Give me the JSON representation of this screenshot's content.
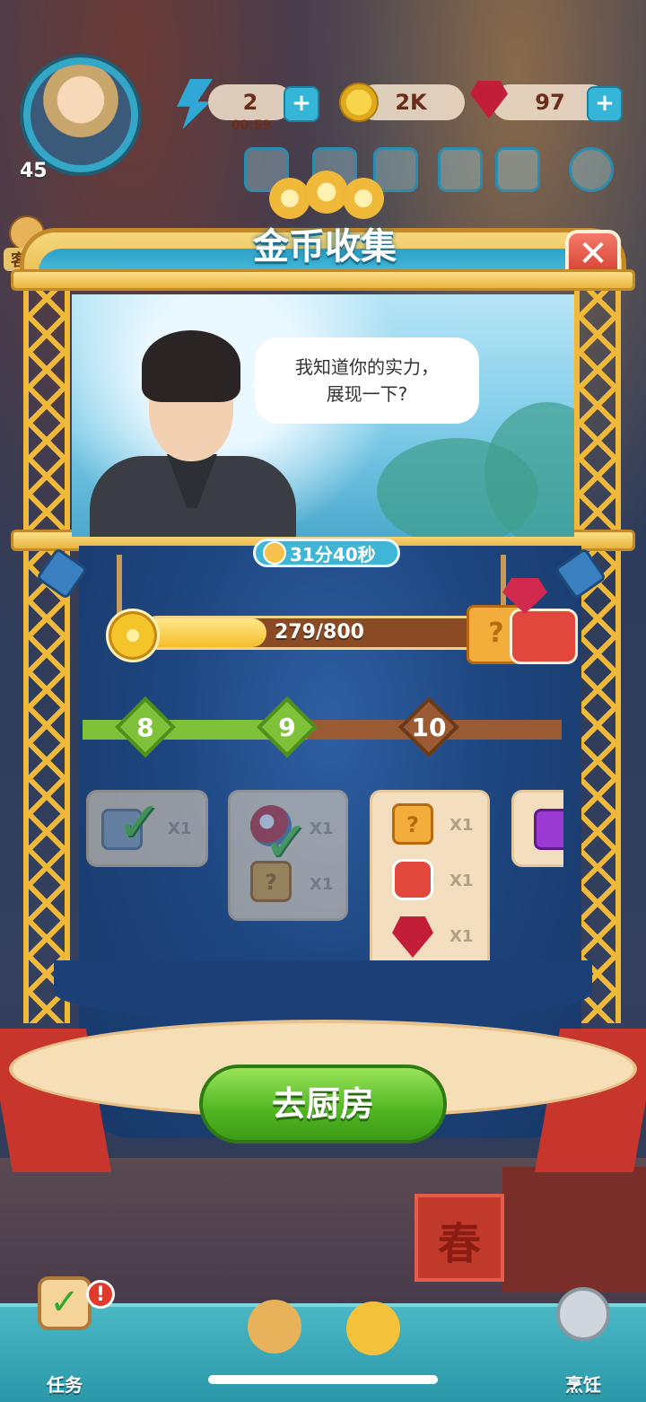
{
  "hud": {
    "level": "45",
    "energy_value": "2",
    "energy_timer": "00:59",
    "coins": "2K",
    "gems": "97",
    "plus": "+",
    "service_label": "客服",
    "top_icons": [
      "gift-icon",
      "clothes-icon",
      "friends-icon",
      "book-icon",
      "mail-icon",
      "settings-icon"
    ]
  },
  "modal": {
    "title": "金币收集",
    "close_symbol": "✕",
    "speech_line1": "我知道你的实力，",
    "speech_line2": "展现一下?",
    "countdown": "31分40秒",
    "progress_text": "279/800",
    "progress_fraction": 0.349,
    "milestones": [
      {
        "label": "8",
        "state": "done"
      },
      {
        "label": "9",
        "state": "done"
      },
      {
        "label": "10",
        "state": "pending"
      }
    ],
    "rewards": [
      {
        "items": [
          {
            "icon": "steel-box-icon",
            "qty": "X1"
          }
        ],
        "claimed": true
      },
      {
        "items": [
          {
            "icon": "bubble-icon",
            "qty": "X1"
          },
          {
            "icon": "mystery-box-icon",
            "qty": "X1"
          }
        ],
        "claimed": true
      },
      {
        "items": [
          {
            "icon": "mystery-box-icon",
            "qty": "X1"
          },
          {
            "icon": "red-chest-icon",
            "qty": "X1"
          },
          {
            "icon": "ruby-icon",
            "qty": "X1"
          }
        ],
        "claimed": false
      },
      {
        "items": [
          {
            "icon": "purple-chest-icon",
            "qty": ""
          }
        ],
        "claimed": false
      }
    ],
    "go_button": "去厨房",
    "mystery_box_mark": "?"
  },
  "nav": {
    "items": [
      "任务",
      "",
      "",
      "烹饪"
    ],
    "alert": "!"
  },
  "background": {
    "poster_char": "春"
  },
  "colors": {
    "accent_gold": "#f0b93a",
    "accent_blue": "#35b6d8",
    "button_green": "#4fb620",
    "milestone_done": "#7fc23a",
    "milestone_pending": "#9a5a34"
  }
}
